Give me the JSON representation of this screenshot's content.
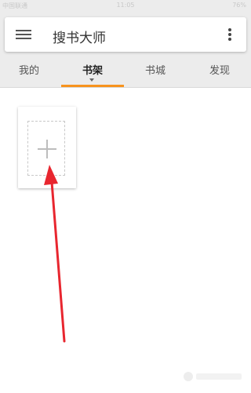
{
  "status_bar": {
    "carrier": "中国联通",
    "time": "11:05",
    "battery": "76%"
  },
  "header": {
    "title": "搜书大师",
    "menu_icon": "hamburger-menu-icon",
    "more_icon": "more-vertical-icon"
  },
  "tabs": [
    {
      "label": "我的",
      "active": false
    },
    {
      "label": "书架",
      "active": true
    },
    {
      "label": "书城",
      "active": false
    },
    {
      "label": "发现",
      "active": false
    }
  ],
  "bookshelf": {
    "add_icon": "plus-icon"
  },
  "colors": {
    "accent": "#f7931e",
    "annotation_arrow": "#e8262f",
    "background_bar": "#ececec"
  }
}
